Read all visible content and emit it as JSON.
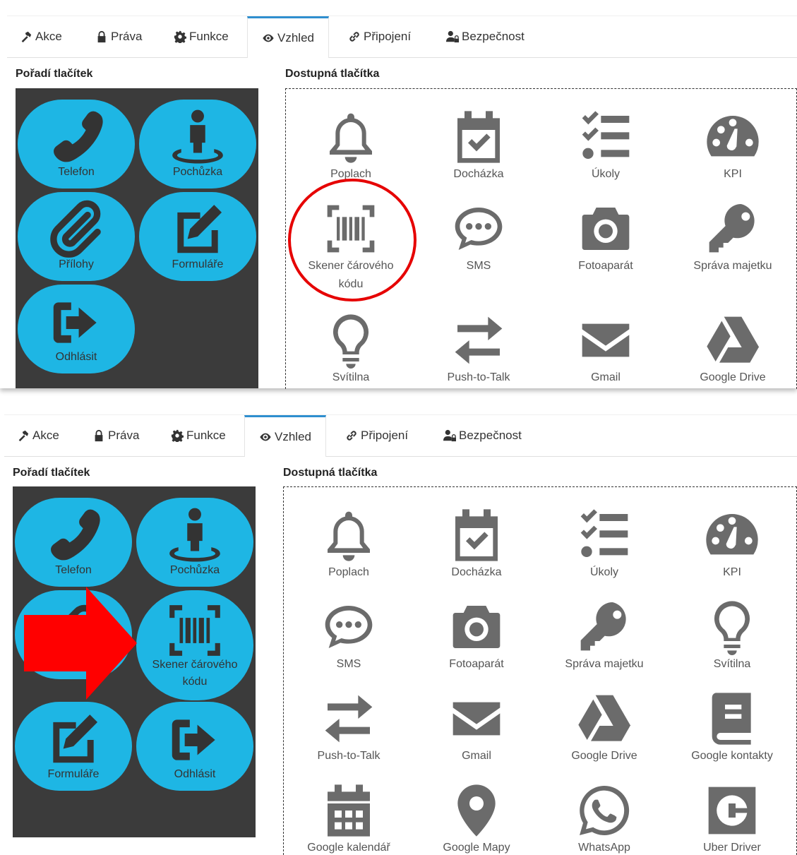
{
  "tabs": [
    "Akce",
    "Práva",
    "Funkce",
    "Vzhled",
    "Připojení",
    "Bezpečnost"
  ],
  "left_title": "Pořadí tlačítek",
  "right_title": "Dostupná tlačítka",
  "before": {
    "order": [
      "Telefon",
      "Pochůzka",
      "Přílohy",
      "Formuláře",
      "Odhlásit"
    ],
    "available": [
      "Poplach",
      "Docházka",
      "Úkoly",
      "KPI",
      "Skener čárového kódu",
      "SMS",
      "Fotoaparát",
      "Správa majetku",
      "Svítilna",
      "Push-to-Talk",
      "Gmail",
      "Google Drive"
    ]
  },
  "after": {
    "order": [
      "Telefon",
      "Pochůzka",
      "Skener čárového kódu",
      "Formuláře",
      "Odhlásit"
    ],
    "available": [
      "Poplach",
      "Docházka",
      "Úkoly",
      "KPI",
      "SMS",
      "Fotoaparát",
      "Správa majetku",
      "Svítilna",
      "Push-to-Talk",
      "Gmail",
      "Google Drive",
      "Google kontakty",
      "Google kalendář",
      "Google Mapy",
      "WhatsApp",
      "Uber Driver"
    ]
  },
  "colors": {
    "accent": "#1eb6e4",
    "phone_bg": "#3b3b3b",
    "icon": "#6b6b6b",
    "highlight": "#e60000",
    "active_tab": "#2f8fcf"
  }
}
